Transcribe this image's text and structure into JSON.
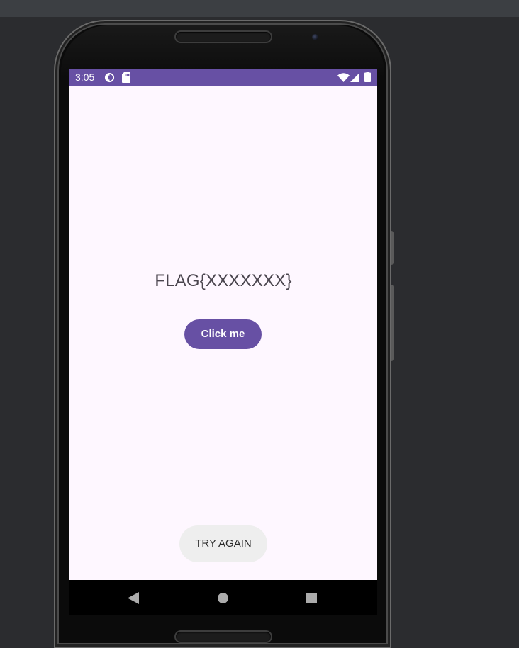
{
  "status_bar": {
    "time": "3:05",
    "left_icons": [
      "data-saver-icon",
      "sd-card-icon"
    ],
    "right_icons": [
      "wifi-icon",
      "cellular-signal-icon",
      "battery-icon"
    ]
  },
  "main": {
    "flag_text": "FLAG{XXXXXXX}",
    "button_label": "Click me"
  },
  "toast": {
    "message": "TRY AGAIN"
  },
  "nav_bar": {
    "icons": [
      "back-icon",
      "home-icon",
      "recents-icon"
    ]
  },
  "colors": {
    "primary": "#6750a4",
    "screen_background": "#fef7ff",
    "toast_background": "#eeeeee"
  }
}
